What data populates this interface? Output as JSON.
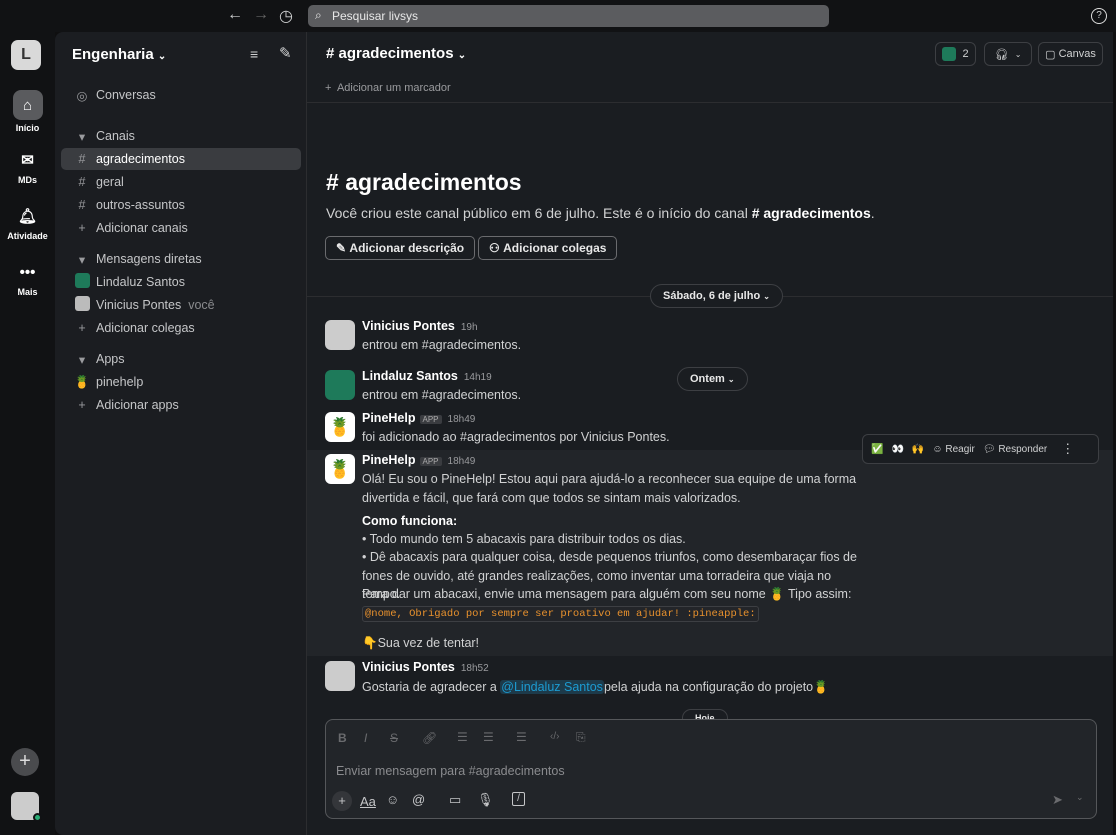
{
  "topbar": {
    "search_placeholder": "Pesquisar livsys",
    "back_icon": "arrow-left-icon",
    "forward_icon": "arrow-right-icon",
    "history_icon": "clock-icon",
    "help_icon": "question-icon"
  },
  "rail": {
    "workspace_initial": "L",
    "items": [
      {
        "label": "Início",
        "icon": "home-icon"
      },
      {
        "label": "MDs",
        "icon": "dm-icon"
      },
      {
        "label": "Atividade",
        "icon": "bell-icon"
      },
      {
        "label": "Mais",
        "icon": "more-icon"
      }
    ]
  },
  "sidebar": {
    "workspace": "Engenharia",
    "conversations": "Conversas",
    "channels_header": "Canais",
    "channels": [
      "agradecimentos",
      "geral",
      "outros-assuntos"
    ],
    "add_channels": "Adicionar canais",
    "dm_header": "Mensagens diretas",
    "dms": [
      {
        "name": "Lindaluz Santos",
        "suffix": ""
      },
      {
        "name": "Vinicius Pontes",
        "suffix": "você"
      }
    ],
    "add_colleagues": "Adicionar colegas",
    "apps_header": "Apps",
    "apps": [
      "pinehelp"
    ],
    "add_apps": "Adicionar apps"
  },
  "channel": {
    "title": "# agradecimentos",
    "members_count": "2",
    "canvas": "Canvas",
    "add_bookmark": "Adicionar um marcador",
    "intro_title": "agradecimentos",
    "intro_text": "Você criou este canal público em 6 de julho. Este é o início do canal ",
    "intro_channel": "# agradecimentos",
    "intro_end": ".",
    "add_description": "Adicionar descrição",
    "add_colleagues": "Adicionar colegas",
    "date_divider": "Sábado, 6 de julho",
    "date_divider2": "Ontem",
    "date_divider3": "Hoje"
  },
  "messages": [
    {
      "author": "Vinicius Pontes",
      "time": "19h",
      "text": "entrou em #agradecimentos."
    },
    {
      "author": "Lindaluz Santos",
      "time": "14h19",
      "text": "entrou em #agradecimentos."
    },
    {
      "author": "PineHelp",
      "badge": "APP",
      "time": "18h49",
      "text": "foi adicionado ao #agradecimentos por Vinicius Pontes."
    },
    {
      "author": "PineHelp",
      "badge": "APP",
      "time": "18h49",
      "intro": "Olá! Eu sou o PineHelp! Estou aqui para ajudá-lo a reconhecer sua equipe de uma forma divertida e fácil, que fará com que todos se sintam mais valorizados.",
      "heading": "Como funciona:",
      "bullet1": "• Todo mundo tem 5 abacaxis para distribuir todos os dias.",
      "bullet2": "• Dê abacaxis para qualquer coisa, desde pequenos triunfos, como desembaraçar fios de fones de ouvido, até grandes realizações, como inventar uma torradeira que viaja no tempo.",
      "how": "Para dar um abacaxi, envie uma mensagem para alguém com seu nome",
      "how2": " Tipo assim:",
      "code": "@nome, Obrigado por sempre ser proativo em ajudar! :pineapple:",
      "try": "Sua vez de tentar!"
    },
    {
      "author": "Vinicius Pontes",
      "time": "18h52",
      "text_before": "Gostaria de agradecer a ",
      "mention": "@Lindaluz Santos",
      "text_after": "pela ajuda na configuração do projeto"
    }
  ],
  "hover_actions": {
    "react": "Reagir",
    "reply": "Responder"
  },
  "composer": {
    "placeholder": "Enviar mensagem para #agradecimentos",
    "format": "Aa"
  }
}
